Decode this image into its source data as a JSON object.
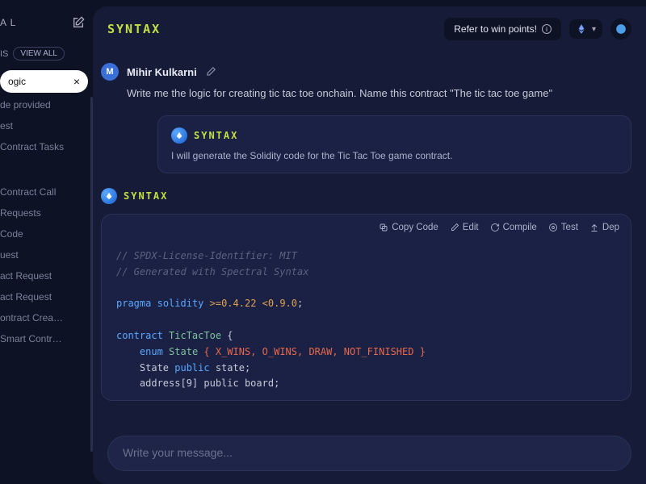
{
  "sidebar": {
    "top_label": "A L",
    "sessions_label": "IS",
    "view_all": "VIEW ALL",
    "active": "ogic",
    "items": [
      "de provided",
      "est",
      "Contract Tasks",
      "",
      "Contract Call",
      "Requests",
      "Code",
      "uest",
      "act Request",
      "act Request",
      "ontract Crea…",
      "Smart Contr…"
    ]
  },
  "topbar": {
    "title": "SYNTAX",
    "refer": "Refer to win points!"
  },
  "chat": {
    "user_initial": "M",
    "user_name": "Mihir Kulkarni",
    "user_msg": "Write me the logic for creating tic tac toe onchain. Name this contract \"The tic tac toe game\"",
    "ai_name": "SYNTAX",
    "ai_msg": "I will generate the Solidity code for the Tic Tac Toe game contract."
  },
  "code_toolbar": {
    "copy": "Copy Code",
    "edit": "Edit",
    "compile": "Compile",
    "test": "Test",
    "deploy": "Dep"
  },
  "code": {
    "c1": "// SPDX-License-Identifier: MIT",
    "c2": "// Generated with Spectral Syntax",
    "pragma_kw": "pragma",
    "solidity_kw": "solidity",
    "ver": ">=0.4.22 <0.9.0",
    "semi": ";",
    "contract_kw": "contract",
    "contract_name": "TicTacToe",
    "brace_open": " {",
    "enum_kw": "enum",
    "enum_name": "State",
    "enum_body": " { X_WINS, O_WINS, DRAW, NOT_FINISHED }",
    "state_decl": "    State ",
    "public_kw": "public",
    "state_var": " state;",
    "addr_line": "    address[9] public board;"
  },
  "input": {
    "placeholder": "Write your message..."
  }
}
